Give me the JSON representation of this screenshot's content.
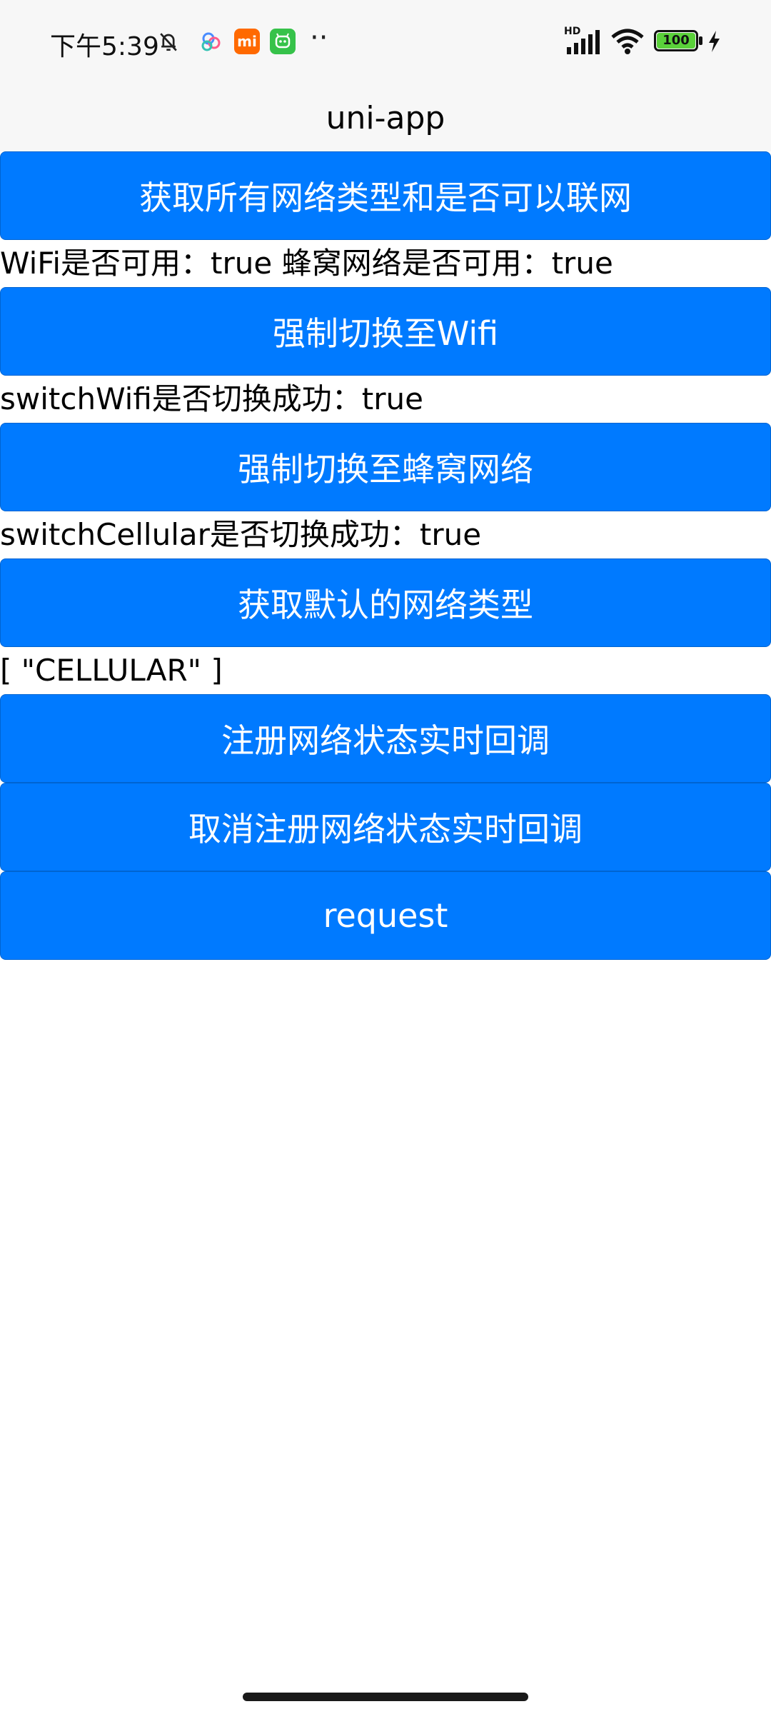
{
  "status_bar": {
    "time": "下午5:39",
    "network_badge": "HD",
    "battery": "100",
    "app_icon_mi": "mi",
    "colors": {
      "mi_icon": "#ff6900",
      "green_icon": "#36c24a",
      "battery_fill": "#5ad13a"
    }
  },
  "nav": {
    "title": "uni-app"
  },
  "main": {
    "buttons": {
      "get_all_network": "获取所有网络类型和是否可以联网",
      "switch_wifi": "强制切换至Wifi",
      "switch_cellular": "强制切换至蜂窝网络",
      "get_default_type": "获取默认的网络类型",
      "register_callback": "注册网络状态实时回调",
      "unregister_callback": "取消注册网络状态实时回调",
      "request": "request"
    },
    "results": {
      "availability": "WiFi是否可用：true 蜂窝网络是否可用：true",
      "switch_wifi": "switchWifi是否切换成功：true",
      "switch_cellular": "switchCellular是否切换成功：true",
      "default_type": "[ \"CELLULAR\" ]"
    }
  },
  "colors": {
    "primary": "#007aff",
    "header_bg": "#f7f7f7"
  }
}
